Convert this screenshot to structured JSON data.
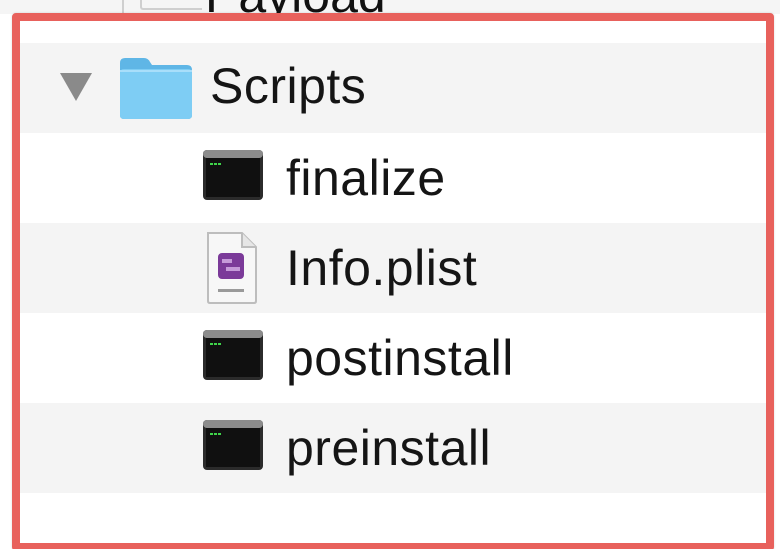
{
  "rows": [
    {
      "label": "Scripts",
      "kind": "folder",
      "expanded": true
    },
    {
      "label": "finalize",
      "kind": "terminal-script"
    },
    {
      "label": "Info.plist",
      "kind": "plist-file"
    },
    {
      "label": "postinstall",
      "kind": "terminal-script"
    },
    {
      "label": "preinstall",
      "kind": "terminal-script"
    }
  ],
  "above_row_label": "Payload",
  "highlight_color": "#e8615c",
  "folder_color": "#6fc3ef"
}
